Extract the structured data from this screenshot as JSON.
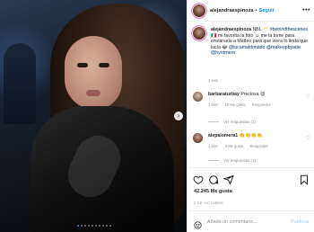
{
  "post": {
    "photo_alt": "",
    "carousel_dots": 10,
    "active_dot": 0
  },
  "header": {
    "username": "alejandraespinoza",
    "separator": "•",
    "follow_label": "Seguir",
    "more_label": "•••"
  },
  "caption": {
    "username": "alejandraespinoza",
    "text_1": "NBL",
    "tag_1": "#behindthescenes",
    "text_2": "mi favorita la foto",
    "text_3": "☺ me la tome para enviársela a Matteo para que viera lo linda que lucía",
    "mention_1": "@lucamaldonado",
    "mention_2": "@makeupbyade",
    "mention_3": "@hyromero",
    "time": "1 sem"
  },
  "comments": [
    {
      "username": "barbaraturbay",
      "text": "Preciosa",
      "time": "1 sem",
      "likes": "10 Me gusta",
      "reply": "Responder",
      "view_replies": "Ver respuestas (1)"
    },
    {
      "username": "alepalomera1",
      "text": "👏👏👏👏",
      "time": "1 sem",
      "likes": "4 Me gusta",
      "reply": "Responder",
      "view_replies": "Ver respuestas (1)"
    }
  ],
  "actions": {
    "like_icon": "heart-icon",
    "comment_icon": "comment-icon",
    "share_icon": "share-icon",
    "save_icon": "bookmark-icon"
  },
  "likes_text": "42.245 Me gusta",
  "date_text": "2 DE OCTUBRE",
  "add_comment": {
    "placeholder": "Añade un comentario...",
    "publish_label": "Publicar"
  },
  "colors": {
    "link_blue": "#0095f6",
    "publish_disabled": "#b2dffc",
    "muted_text": "#8e8e8e"
  }
}
